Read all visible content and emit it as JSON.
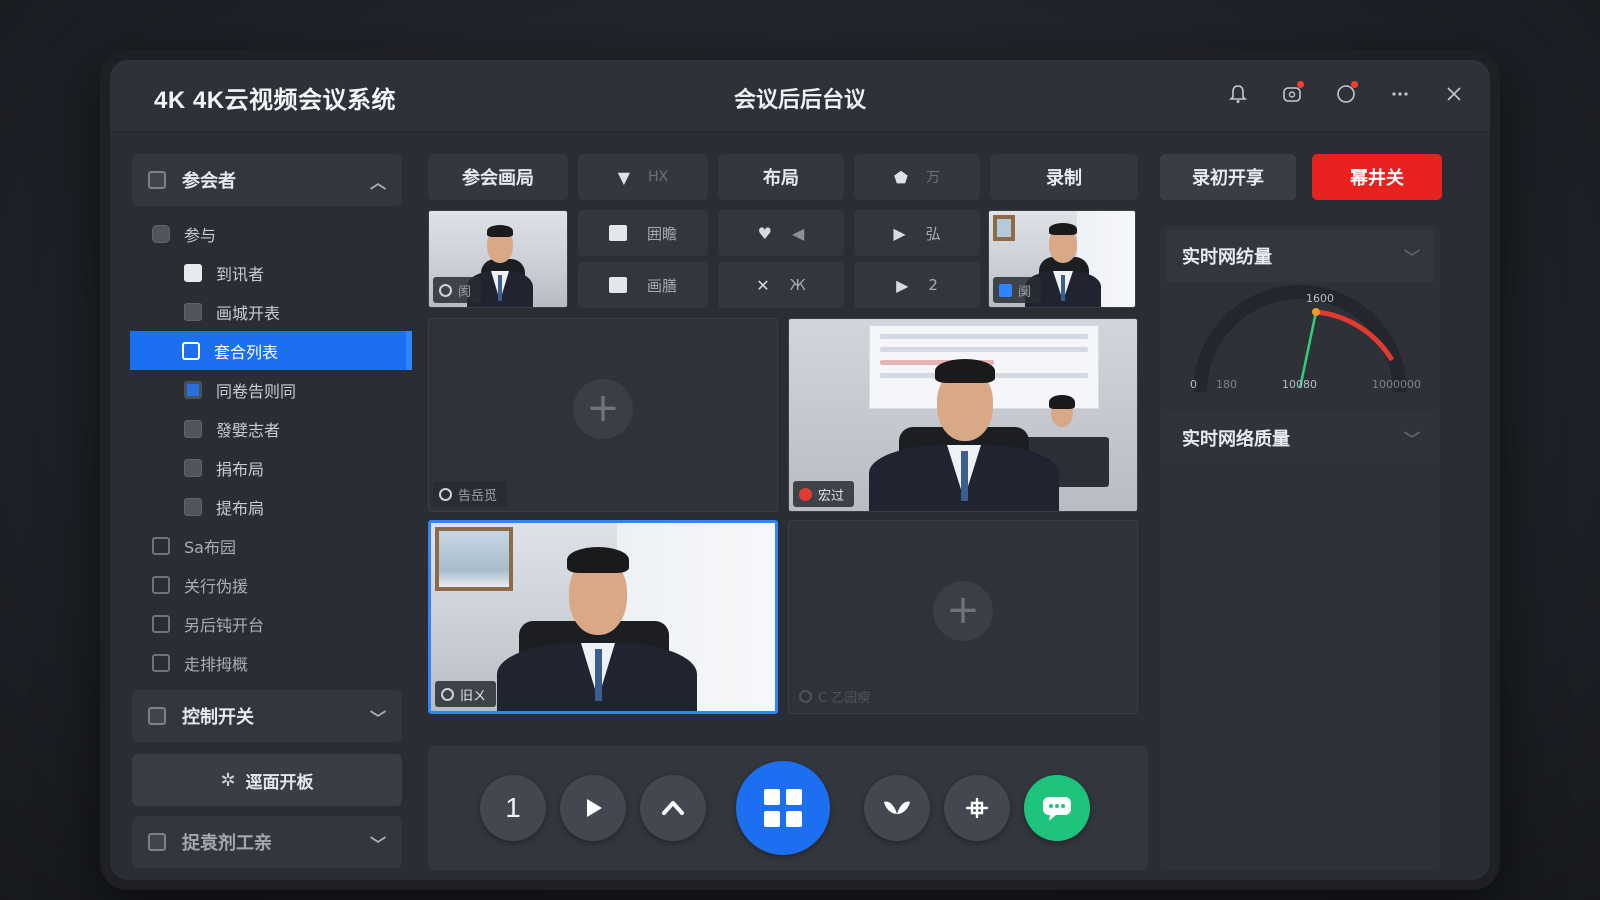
{
  "app": {
    "logo": "4K",
    "title": "4K云视频会议系统",
    "window_title": "会议后后台议"
  },
  "title_icons": [
    {
      "name": "bell-icon",
      "glyph": "⛶"
    },
    {
      "name": "notification-icon",
      "glyph": "◎"
    },
    {
      "name": "status-icon",
      "glyph": "○"
    },
    {
      "name": "more-icon",
      "glyph": "⋯"
    },
    {
      "name": "close-icon",
      "glyph": "✕"
    }
  ],
  "sidebar": {
    "participants_header": "参会者",
    "tree": {
      "group": "参与",
      "items": [
        "到讯者",
        "画城开表",
        "套合列表",
        "同卷告则同",
        "發嬖志者",
        "捐布局",
        "提布扃"
      ]
    },
    "other_items": [
      "Sa布园",
      "关行伪援",
      "另后钝开台",
      "走排拇概"
    ],
    "control_header": "控制开关",
    "action_button": "逕面开板",
    "bottom_header": "捉袁剂工亲"
  },
  "toolbar": {
    "layout_btn": "参会画局",
    "dropdown_muted": "HX",
    "layout": "布局",
    "shield_muted": "万",
    "record": "录制"
  },
  "controls": {
    "row1_label": "囲瞻",
    "row2_label": "画膳",
    "row1_muted": "弘",
    "row2_muted": "Ж",
    "row1_num": "2",
    "row2_num": "2"
  },
  "tiles": {
    "small_left_label": "阂",
    "small_right_label": "阒",
    "empty_top_label": "告岳觅",
    "speaker_label": "宏过",
    "active_label": "旧ㄨ",
    "empty_bottom_label": "C 乙园瘐"
  },
  "right_panel": {
    "record_share": "录初开享",
    "stop": "幂井关",
    "network_header": "实时网纺量",
    "quality_header": "实时网络质量",
    "gauge_ticks": [
      "0",
      "180",
      "1600",
      "10080",
      "1000000"
    ]
  },
  "bottom_controls": {
    "btn1": "1"
  },
  "colors": {
    "accent": "#1b6ff0",
    "danger": "#e8221f",
    "chat": "#1ec47c"
  }
}
